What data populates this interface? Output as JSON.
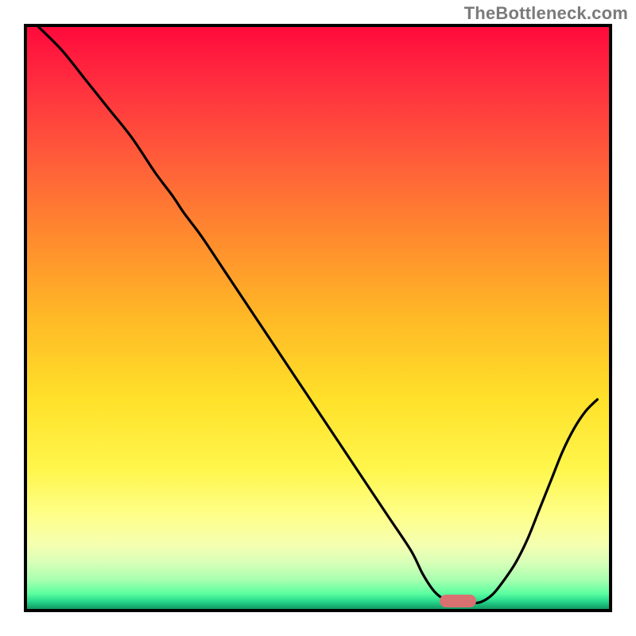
{
  "watermark": "TheBottleneck.com",
  "colors": {
    "frame_border": "#000000",
    "curve": "#000000",
    "marker": "#d97171",
    "gradient_top": "#ff0a3c",
    "gradient_bottom": "#149762"
  },
  "chart_data": {
    "type": "line",
    "title": "",
    "xlabel": "",
    "ylabel": "",
    "xlim": [
      0,
      100
    ],
    "ylim": [
      0,
      100
    ],
    "grid": false,
    "x": [
      2,
      6,
      10,
      14,
      18,
      22,
      25,
      27,
      30,
      34,
      38,
      42,
      46,
      50,
      54,
      58,
      62,
      66,
      68,
      70,
      72,
      74,
      76,
      78,
      80,
      82,
      84,
      86,
      88,
      90,
      92,
      94,
      96,
      98
    ],
    "values": [
      100,
      96,
      91,
      86,
      81,
      75,
      71,
      68,
      64,
      58,
      52,
      46,
      40,
      34,
      28,
      22,
      16,
      10,
      6,
      3,
      1.5,
      1,
      1,
      1.2,
      2.5,
      5,
      8,
      12,
      17,
      22,
      27,
      31,
      34,
      36
    ],
    "marker": {
      "x": 74,
      "y": 1.3
    },
    "annotations": []
  }
}
